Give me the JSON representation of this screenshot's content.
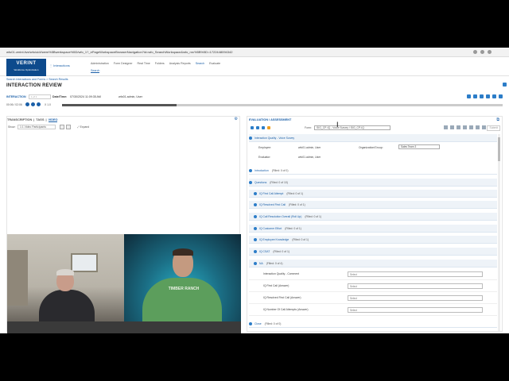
{
  "browser": {
    "url": "wfo01.verint.live/wfo/ui/#/wem%5Bwerkspace%5D/wfo_1?_ePageWorkspaceBrowserNavigation?id=wfo_SearchWorkspace&wfo_nrc%5B%5D=1722448094342",
    "user_initials": "UW"
  },
  "app": {
    "logo": "VERINT",
    "logo_sub": "Workforce Optimization",
    "module": "Interactions"
  },
  "topnav": {
    "items": [
      "Administration",
      "Form Designer",
      "Real Time",
      "Folders",
      "Analysis Reports",
      "Search",
      "Evaluate"
    ],
    "active": "Search",
    "sub": "Search"
  },
  "breadcrumb": "Search Interactions and Forms  >  Search Results",
  "page_title": "INTERACTION REVIEW",
  "interaction": {
    "label": "INTERACTION",
    "select_placeholder": "1 of 1",
    "date_label": "Date/Time:",
    "date_value": "07/30/2024 11:09:35 AM",
    "user": "wfo01.admin, User"
  },
  "player": {
    "time": "00:06 / 02:06",
    "speed": "X 1.0",
    "progress_fraction": 0.26
  },
  "left_panel": {
    "tabs": [
      "TRANSCRIPTION",
      "TAGS",
      "VIDEO"
    ],
    "active_tab": "VIDEO",
    "show_label": "Show:",
    "show_value": "1:1 Video Participants",
    "expand_label": "Expand",
    "shirt_text": "TIMBER RANCH"
  },
  "right_panel": {
    "title": "EVALUATION / ASSESSMENT",
    "form_label": "Form:",
    "form_value": "SIG_CP-IQ - Voice Survey / SIG_CP-IQ",
    "submit_label": "Submit",
    "header_section": "Interaction Quality - Voice Survey",
    "employee_label": "Employee:",
    "employee_value": "wfo01.admin, User",
    "org_label": "Organization/Group:",
    "org_value": "Sales Team 3",
    "evaluator_label": "Evaluator:",
    "evaluator_value": "wfo01.admin, User",
    "sections": [
      {
        "name": "Introduction",
        "filled": "(Filled: 0 of 0)"
      },
      {
        "name": "Questions",
        "filled": "(Filled: 0 of 10)"
      },
      {
        "name": "IQ First Call Attempt",
        "filled": "(Filled: 0 of 1)"
      },
      {
        "name": "IQ Resolved First Call",
        "filled": "(Filled: 0 of 1)"
      },
      {
        "name": "IQ Call Resolution Overall (Roll Up)",
        "filled": "(Filled: 0 of 1)"
      },
      {
        "name": "IQ Customer Effort",
        "filled": "(Filled: 0 of 1)"
      },
      {
        "name": "IQ Employee Knowledge",
        "filled": "(Filled: 0 of 1)"
      },
      {
        "name": "IQ CSAT",
        "filled": "(Filled: 0 of 1)"
      },
      {
        "name": "NA",
        "filled": "(Filled: 0 of 4)"
      }
    ],
    "answers": [
      {
        "q": "Interaction Quality - Comment",
        "v": "Select"
      },
      {
        "q": "IQ First Call (Answer)",
        "v": "Select"
      },
      {
        "q": "IQ Resolved First Call (Answer)",
        "v": "Select"
      },
      {
        "q": "IQ Number Of Call Attempts (Answer)",
        "v": "Select"
      }
    ],
    "closing": {
      "name": "Close",
      "filled": "(Filled: 0 of 0)"
    }
  }
}
